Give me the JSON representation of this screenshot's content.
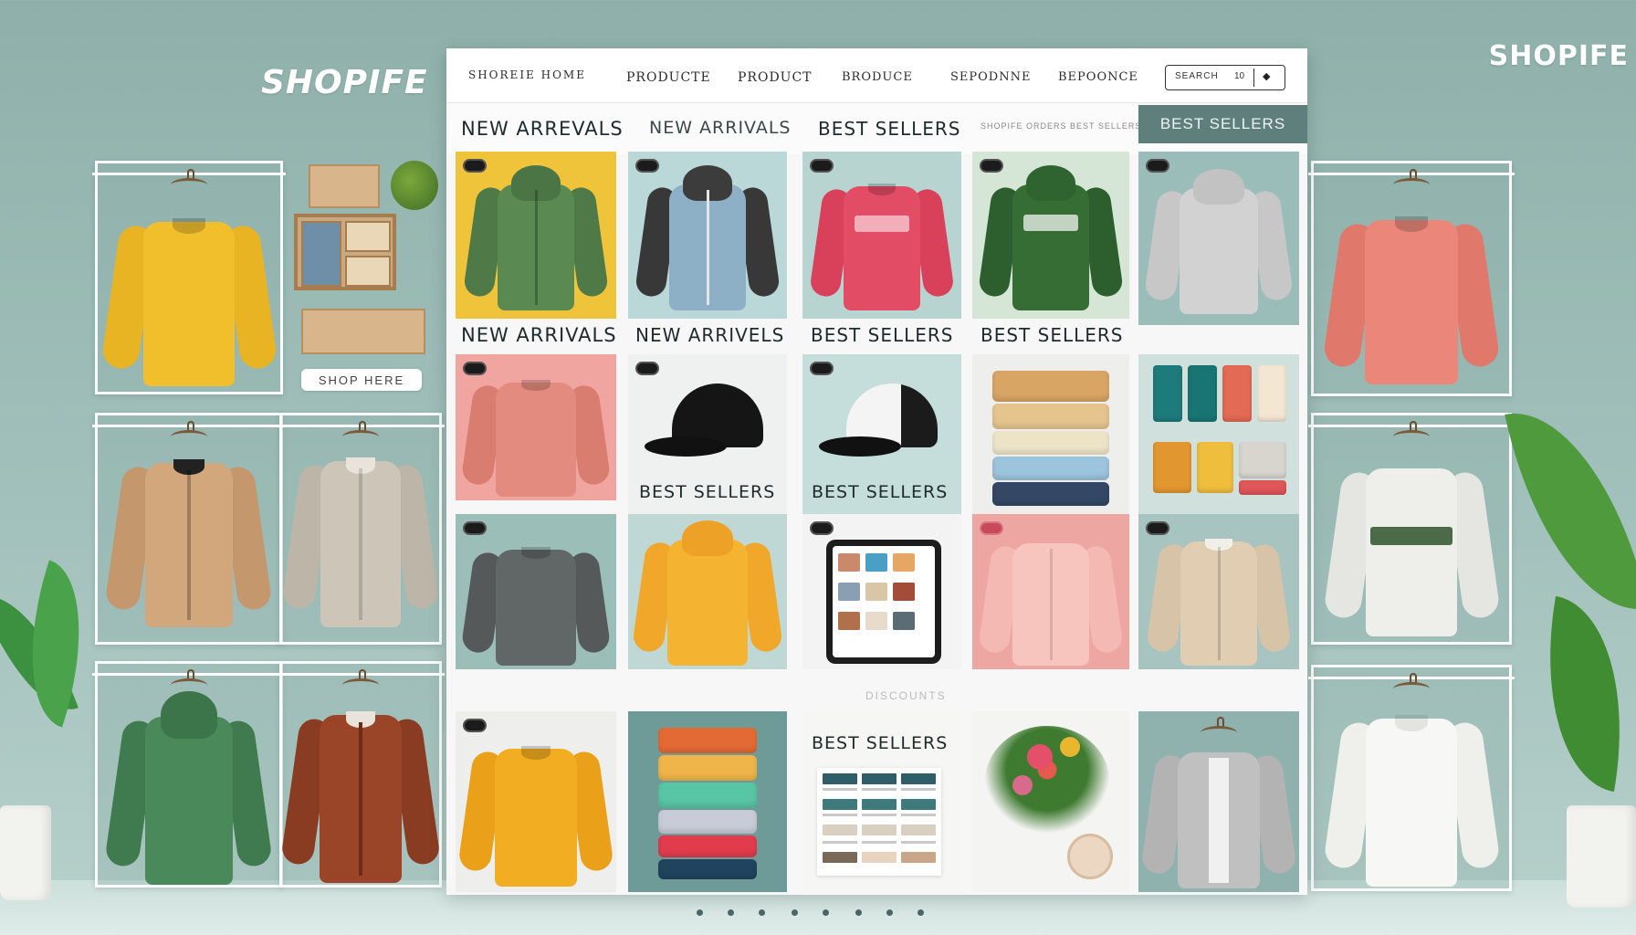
{
  "brand": {
    "left": "SHOPIFE",
    "right": "SHOPIFE"
  },
  "decor": {
    "pill_label": "SHOP HERE"
  },
  "nav": {
    "items": [
      "SHOREIE HOME",
      "PRODUCTE",
      "PRODUCT",
      "BRODUCE",
      "SEPODNNE",
      "BEPOONCE"
    ],
    "search_label": "SEARCH",
    "search_badge": "10"
  },
  "categories": {
    "items": [
      "NEW ARREVALS",
      "NEW ARRIVALS",
      "BEST SELLERS"
    ],
    "small_text": "SHOPIFE ORDERS BEST SELLERS",
    "active": "BEST SELLERS"
  },
  "captions": {
    "row1": [
      "NEW ARRIVALS",
      "NEW ARRIVELS",
      "BEST SELLERS",
      "BEST SELLERS"
    ],
    "row2": [
      "BEST SELLERS",
      "BEST SELLERS"
    ],
    "row4": "BEST SELLERS",
    "faint": "DISCOUNTS"
  },
  "colors": {
    "panel_bg": "#f6f7f6",
    "active_tab": "#5f7f7c",
    "background": "#a3c1bc"
  },
  "pagination": {
    "count": 8,
    "active": 0
  }
}
